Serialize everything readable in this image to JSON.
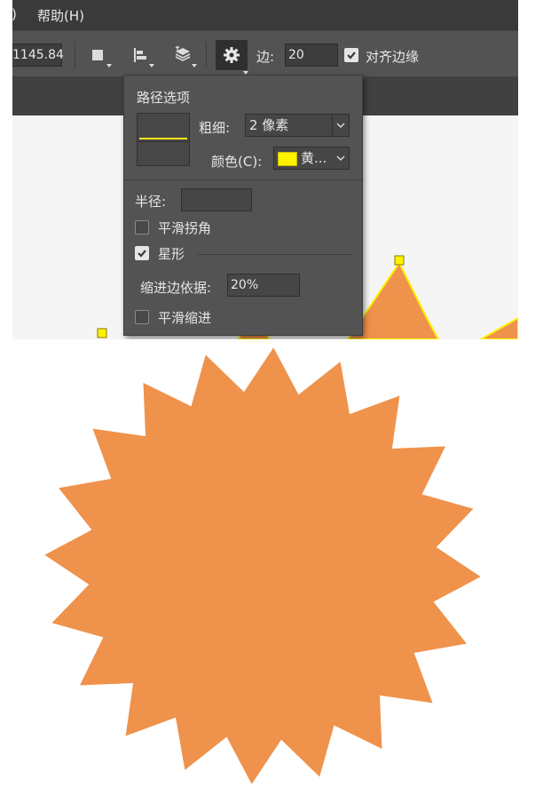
{
  "menu": {
    "partial_item": ")",
    "help": "帮助(H)"
  },
  "toolbar": {
    "coordinate_value": "1145.84",
    "sides_label": "边:",
    "sides_value": "20",
    "align_edges_label": "对齐边缘",
    "align_edges_checked": true
  },
  "path_options": {
    "title": "路径选项",
    "weight_label": "粗细:",
    "weight_value": "2 像素",
    "color_label": "颜色(C):",
    "color_value": "黄...",
    "color_swatch": "#fff200",
    "radius_label": "半径:",
    "radius_value": "",
    "smooth_corners_label": "平滑拐角",
    "smooth_corners_checked": false,
    "star_label": "星形",
    "star_checked": true,
    "indent_label": "缩进边依据:",
    "indent_value": "20%",
    "smooth_indent_label": "平滑缩进",
    "smooth_indent_checked": false
  },
  "colors": {
    "shape_fill": "#ef924b",
    "path_stroke": "#fff200",
    "panel_bg": "#535353"
  },
  "star": {
    "points": 20,
    "indent_percent": 20
  }
}
